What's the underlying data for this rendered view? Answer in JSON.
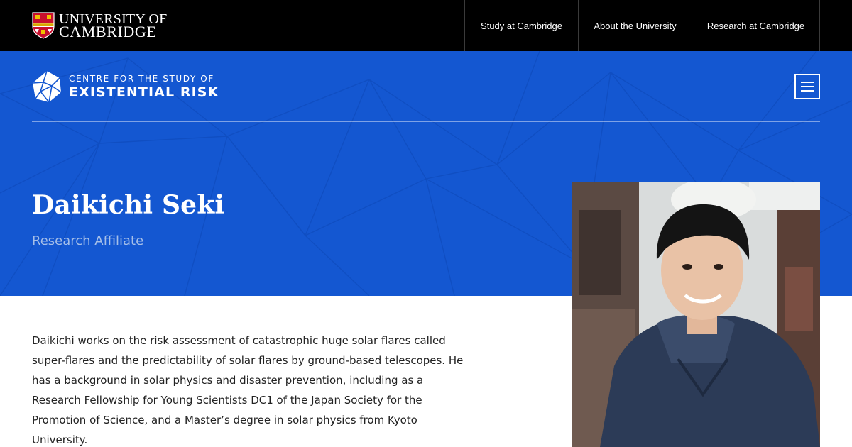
{
  "topbar": {
    "logo": {
      "line1": "UNIVERSITY OF",
      "line2": "CAMBRIDGE",
      "icon": "university-shield-icon"
    },
    "nav": [
      {
        "label": "Study at Cambridge"
      },
      {
        "label": "About the University"
      },
      {
        "label": "Research at Cambridge"
      }
    ]
  },
  "header": {
    "logo": {
      "line1": "CENTRE FOR THE STUDY OF",
      "line2": "EXISTENTIAL RISK",
      "icon": "cser-polyhedron-icon"
    },
    "menu_icon": "hamburger-menu-icon"
  },
  "profile": {
    "name": "Daikichi Seki",
    "role": "Research Affiliate",
    "photo_alt": "Portrait photo of Daikichi Seki",
    "bio": "Daikichi works on the risk assessment of catastrophic huge solar flares called super-flares and the predictability of solar flares by ground-based telescopes. He has a background in solar physics and disaster prevention, including as a Research Fellowship for Young Scientists DC1 of the Japan Society for the Promotion of Science, and a Master’s degree in solar physics from Kyoto University."
  },
  "colors": {
    "topbar": "#000000",
    "hero": "#1457d1",
    "role_text": "#a6bfe8",
    "body_text": "#222222"
  }
}
